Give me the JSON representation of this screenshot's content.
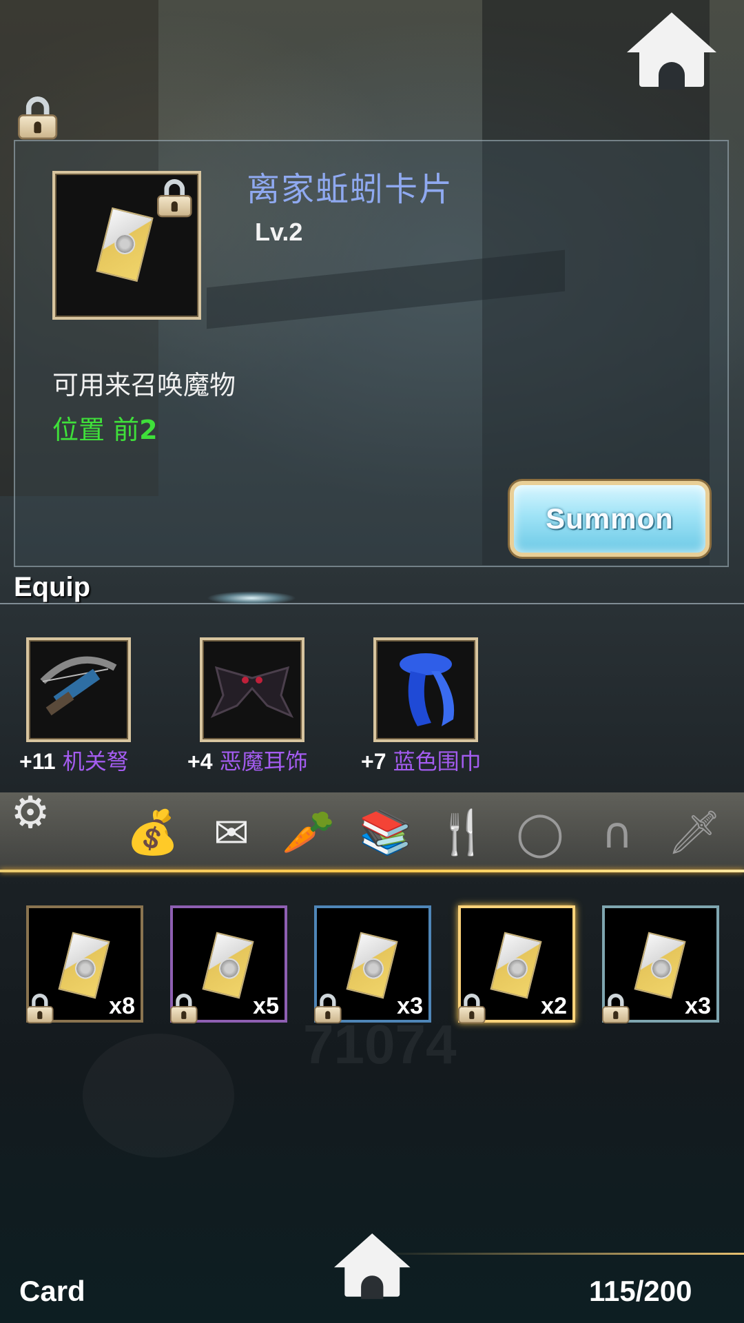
{
  "item": {
    "name": "离家蚯蚓卡片",
    "level": "Lv.2",
    "description": "可用来召唤魔物",
    "position_label": "位置 前",
    "position_value": "2"
  },
  "summon_label": "Summon",
  "equip": {
    "title": "Equip",
    "items": [
      {
        "plus": "+11",
        "name": "机关弩",
        "icon": "crossbow-icon"
      },
      {
        "plus": "+4",
        "name": "恶魔耳饰",
        "icon": "demon-wing-earring-icon"
      },
      {
        "plus": "+7",
        "name": "蓝色围巾",
        "icon": "blue-scarf-icon"
      }
    ]
  },
  "tabs": [
    {
      "icon": "bag-icon",
      "glyph": "💰"
    },
    {
      "icon": "card-icon",
      "glyph": "✉",
      "active": true
    },
    {
      "icon": "carrot-icon",
      "glyph": "🥕"
    },
    {
      "icon": "books-icon",
      "glyph": "📚"
    },
    {
      "icon": "utensils-icon",
      "glyph": "🍴"
    },
    {
      "icon": "ring-icon",
      "glyph": "◯"
    },
    {
      "icon": "cat-ears-icon",
      "glyph": "∩"
    },
    {
      "icon": "sword-icon",
      "glyph": "🗡"
    }
  ],
  "cards": [
    {
      "count": "x8",
      "frame_color": "#8a7450"
    },
    {
      "count": "x5",
      "frame_color": "#8e5fb2"
    },
    {
      "count": "x3",
      "frame_color": "#4f86b8"
    },
    {
      "count": "x2",
      "frame_color": "#ffd37a"
    },
    {
      "count": "x3",
      "frame_color": "#7fa6b0"
    }
  ],
  "footer": {
    "label": "Card",
    "capacity": "115/200"
  }
}
